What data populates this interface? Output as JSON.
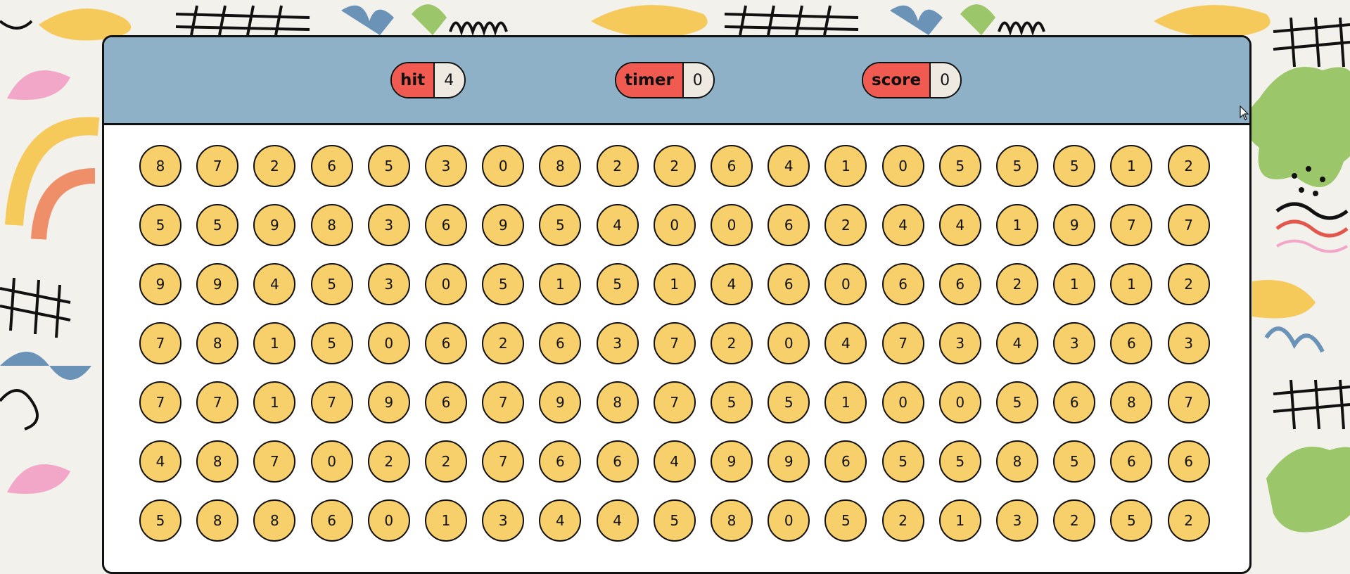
{
  "hud": {
    "hit": {
      "label": "hit",
      "value": "4"
    },
    "timer": {
      "label": "timer",
      "value": "0"
    },
    "score": {
      "label": "score",
      "value": "0"
    }
  },
  "board": {
    "rows": [
      [
        "8",
        "7",
        "2",
        "6",
        "5",
        "3",
        "0",
        "8",
        "2",
        "2",
        "6",
        "4",
        "1",
        "0",
        "5",
        "5",
        "5",
        "1",
        "2"
      ],
      [
        "5",
        "5",
        "9",
        "8",
        "3",
        "6",
        "9",
        "5",
        "4",
        "0",
        "0",
        "6",
        "2",
        "4",
        "4",
        "1",
        "9",
        "7",
        "7"
      ],
      [
        "9",
        "9",
        "4",
        "5",
        "3",
        "0",
        "5",
        "1",
        "5",
        "1",
        "4",
        "6",
        "0",
        "6",
        "6",
        "2",
        "1",
        "1",
        "2"
      ],
      [
        "7",
        "8",
        "1",
        "5",
        "0",
        "6",
        "2",
        "6",
        "3",
        "7",
        "2",
        "0",
        "4",
        "7",
        "3",
        "4",
        "3",
        "6",
        "3"
      ],
      [
        "7",
        "7",
        "1",
        "7",
        "9",
        "6",
        "7",
        "9",
        "8",
        "7",
        "5",
        "5",
        "1",
        "0",
        "0",
        "5",
        "6",
        "8",
        "7"
      ],
      [
        "4",
        "8",
        "7",
        "0",
        "2",
        "2",
        "7",
        "6",
        "6",
        "4",
        "9",
        "9",
        "6",
        "5",
        "5",
        "8",
        "5",
        "6",
        "6"
      ],
      [
        "5",
        "8",
        "8",
        "6",
        "0",
        "1",
        "3",
        "4",
        "4",
        "5",
        "8",
        "0",
        "5",
        "2",
        "1",
        "3",
        "2",
        "5",
        "2"
      ]
    ]
  },
  "colors": {
    "header": "#8fb1c7",
    "pill_label": "#f05a50",
    "mole": "#f7d06b",
    "panel": "#ffffff"
  }
}
